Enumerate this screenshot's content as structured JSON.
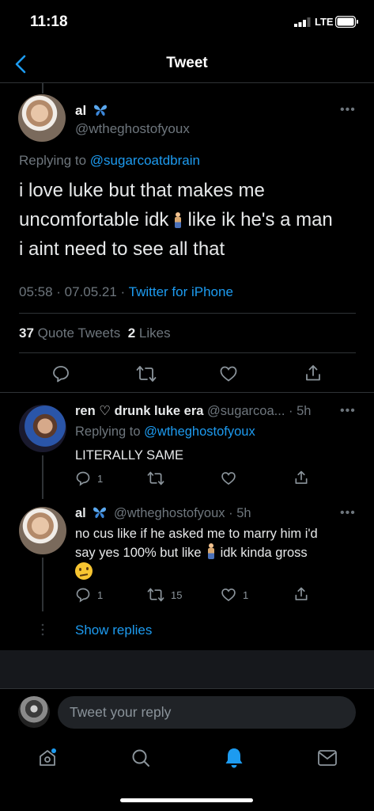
{
  "status_bar": {
    "time": "11:18",
    "network": "LTE"
  },
  "header": {
    "title": "Tweet"
  },
  "main_tweet": {
    "name": "al",
    "handle": "@wtheghostofyoux",
    "replying_prefix": "Replying to",
    "replying_to": "@sugarcoatdbrain",
    "text_1": "i love luke but that makes me",
    "text_2a": "uncomfortable idk",
    "text_2b": "like ik he's a man",
    "text_3": "i aint need to see all that",
    "time_date": "05:58 · 07.05.21 ·",
    "source": "Twitter for iPhone",
    "quote_tweets_count": "37",
    "quote_tweets_label": "Quote Tweets",
    "likes_count": "2",
    "likes_label": "Likes"
  },
  "reply_1": {
    "name": "ren ♡ drunk luke era",
    "handle_time": "@sugarcoa... · 5h",
    "replying_prefix": "Replying to",
    "replying_to": "@wtheghostofyoux",
    "text": "LITERALLY SAME",
    "reply_count": "1"
  },
  "reply_2": {
    "name": "al",
    "handle_time": "@wtheghostofyoux · 5h",
    "text_1": "no cus like if he asked me to marry him i'd",
    "text_2a": "say yes 100% but like",
    "text_2b": "idk kinda gross",
    "reply_count": "1",
    "retweet_count": "15",
    "like_count": "1"
  },
  "show_replies": "Show replies",
  "compose": {
    "placeholder": "Tweet your reply"
  },
  "colors": {
    "accent": "#1d9bf0",
    "background": "#000000",
    "muted": "#6e767d"
  }
}
